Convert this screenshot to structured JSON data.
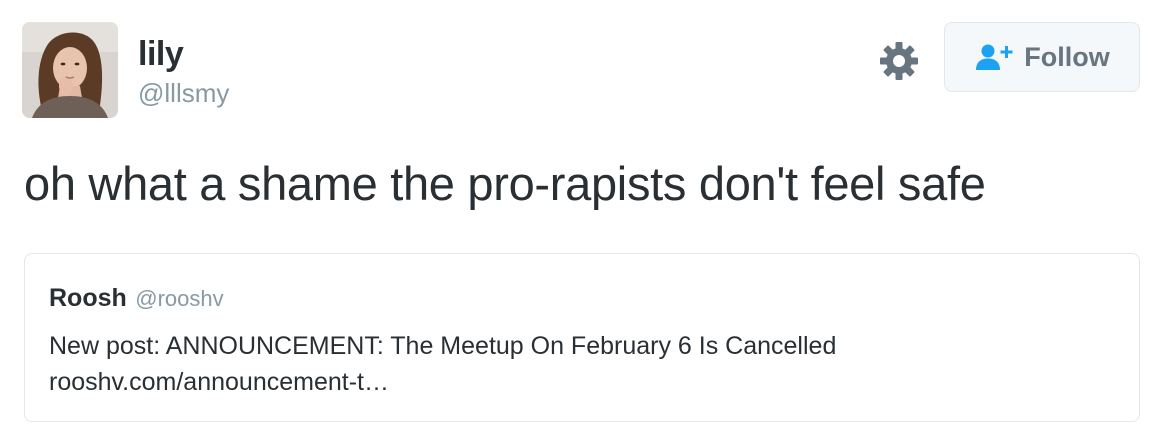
{
  "tweet": {
    "author": {
      "display_name": "lily",
      "screen_name": "@lllsmy",
      "avatar_icon": "user-avatar-photo"
    },
    "actions": {
      "settings_icon": "gear-icon",
      "follow_icon": "add-user-icon",
      "follow_label": "Follow"
    },
    "text": "oh what a shame the pro-rapists don't feel safe",
    "quoted": {
      "display_name": "Roosh",
      "screen_name": "@rooshv",
      "text_line1": "New post: ANNOUNCEMENT: The Meetup On February 6 Is Cancelled",
      "text_line2": "rooshv.com/announcement-t…"
    }
  },
  "colors": {
    "text_primary": "#292f33",
    "text_secondary": "#8899a6",
    "accent": "#1da1f2",
    "border": "#e1e8ed",
    "button_bg": "#f5f8fa",
    "icon_gray": "#66757f"
  }
}
